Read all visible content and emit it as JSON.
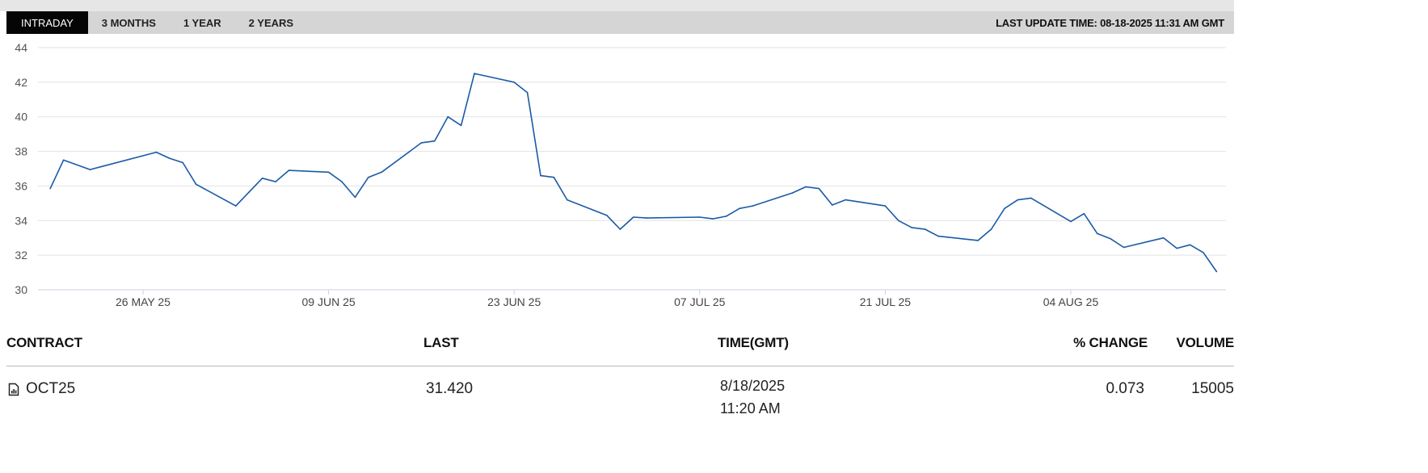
{
  "tabs": [
    {
      "label": "INTRADAY",
      "active": true
    },
    {
      "label": "3 MONTHS",
      "active": false
    },
    {
      "label": "1 YEAR",
      "active": false
    },
    {
      "label": "2 YEARS",
      "active": false
    }
  ],
  "last_update": "LAST UPDATE TIME: 08-18-2025 11:31 AM GMT",
  "colors": {
    "line": "#1a5aa6",
    "grid": "#e2e2e2",
    "tab_active": "#050505",
    "tabbar": "#d5d5d5"
  },
  "chart_data": {
    "type": "line",
    "title": "",
    "xlabel": "",
    "ylabel": "",
    "ylim": [
      30,
      44
    ],
    "y_ticks": [
      30,
      32,
      34,
      36,
      38,
      40,
      42,
      44
    ],
    "x_tick_labels": [
      {
        "label": "26 MAY 25",
        "date": "2025-05-26"
      },
      {
        "label": "09 JUN 25",
        "date": "2025-06-09"
      },
      {
        "label": "23 JUN 25",
        "date": "2025-06-23"
      },
      {
        "label": "07 JUL 25",
        "date": "2025-07-07"
      },
      {
        "label": "21 JUL 25",
        "date": "2025-07-21"
      },
      {
        "label": "04 AUG 25",
        "date": "2025-08-04"
      }
    ],
    "grid": true,
    "legend": "none",
    "series": [
      {
        "x": [
          "2025-05-19",
          "2025-05-20",
          "2025-05-22",
          "2025-05-23",
          "2025-05-27",
          "2025-05-28",
          "2025-05-29",
          "2025-05-30",
          "2025-06-02",
          "2025-06-03",
          "2025-06-04",
          "2025-06-05",
          "2025-06-06",
          "2025-06-09",
          "2025-06-10",
          "2025-06-11",
          "2025-06-12",
          "2025-06-13",
          "2025-06-16",
          "2025-06-17",
          "2025-06-18",
          "2025-06-19",
          "2025-06-20",
          "2025-06-23",
          "2025-06-24",
          "2025-06-25",
          "2025-06-26",
          "2025-06-27",
          "2025-06-30",
          "2025-07-01",
          "2025-07-02",
          "2025-07-03",
          "2025-07-07",
          "2025-07-08",
          "2025-07-09",
          "2025-07-10",
          "2025-07-11",
          "2025-07-14",
          "2025-07-15",
          "2025-07-16",
          "2025-07-17",
          "2025-07-18",
          "2025-07-21",
          "2025-07-22",
          "2025-07-23",
          "2025-07-24",
          "2025-07-25",
          "2025-07-28",
          "2025-07-29",
          "2025-07-30",
          "2025-07-31",
          "2025-08-01",
          "2025-08-04",
          "2025-08-05",
          "2025-08-06",
          "2025-08-07",
          "2025-08-08",
          "2025-08-11",
          "2025-08-12",
          "2025-08-13",
          "2025-08-14",
          "2025-08-15"
        ],
        "values": [
          35.85,
          37.5,
          36.95,
          37.15,
          37.95,
          37.6,
          37.35,
          36.1,
          34.85,
          35.65,
          36.45,
          36.25,
          36.9,
          36.8,
          36.25,
          35.35,
          36.5,
          36.8,
          38.5,
          38.6,
          40.0,
          39.5,
          42.5,
          42.0,
          41.4,
          36.6,
          36.5,
          35.2,
          34.3,
          33.5,
          34.2,
          34.15,
          34.2,
          34.1,
          34.25,
          34.7,
          34.85,
          35.6,
          35.95,
          35.85,
          34.9,
          35.2,
          34.85,
          34.0,
          33.6,
          33.5,
          33.1,
          32.85,
          33.5,
          34.7,
          35.2,
          35.3,
          33.95,
          34.4,
          33.25,
          32.95,
          32.45,
          33.0,
          32.4,
          32.6,
          32.15,
          31.05
        ]
      }
    ]
  },
  "table": {
    "headers": {
      "contract": "CONTRACT",
      "last": "LAST",
      "time": "TIME(GMT)",
      "change": "% CHANGE",
      "volume": "VOLUME"
    },
    "rows": [
      {
        "contract": "OCT25",
        "last": "31.420",
        "date": "8/18/2025",
        "time": "11:20 AM",
        "change": "0.073",
        "volume": "15005",
        "icon": "document-chart-icon"
      }
    ]
  }
}
